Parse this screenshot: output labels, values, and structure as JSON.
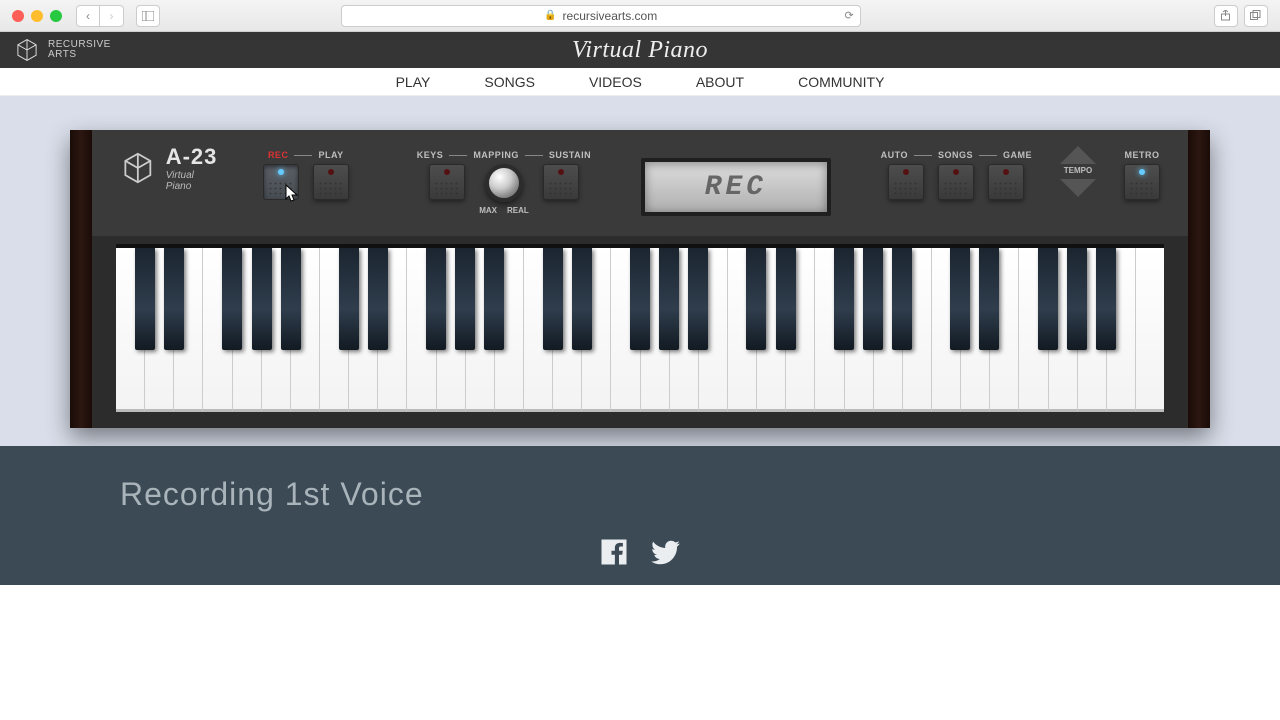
{
  "browser": {
    "url": "recursivearts.com"
  },
  "siteHeader": {
    "logoLine1": "RECURSIVE",
    "logoLine2": "ARTS",
    "scriptTitle": "Virtual Piano"
  },
  "nav": {
    "items": [
      "PLAY",
      "SONGS",
      "VIDEOS",
      "ABOUT",
      "COMMUNITY"
    ]
  },
  "piano": {
    "model": "A-23",
    "subtitle": "Virtual Piano",
    "controls": {
      "rec": "REC",
      "play": "PLAY",
      "keys": "KEYS",
      "mapping": "MAPPING",
      "sustain": "SUSTAIN",
      "mappingMax": "MAX",
      "mappingReal": "REAL",
      "auto": "AUTO",
      "songs": "SONGS",
      "game": "GAME",
      "tempo": "TEMPO",
      "metro": "METRO"
    },
    "lcd": "REC",
    "whiteKeyCount": 36,
    "blackPattern": [
      1,
      1,
      0,
      1,
      1,
      1,
      0
    ]
  },
  "below": {
    "heading": "Recording 1st Voice"
  }
}
